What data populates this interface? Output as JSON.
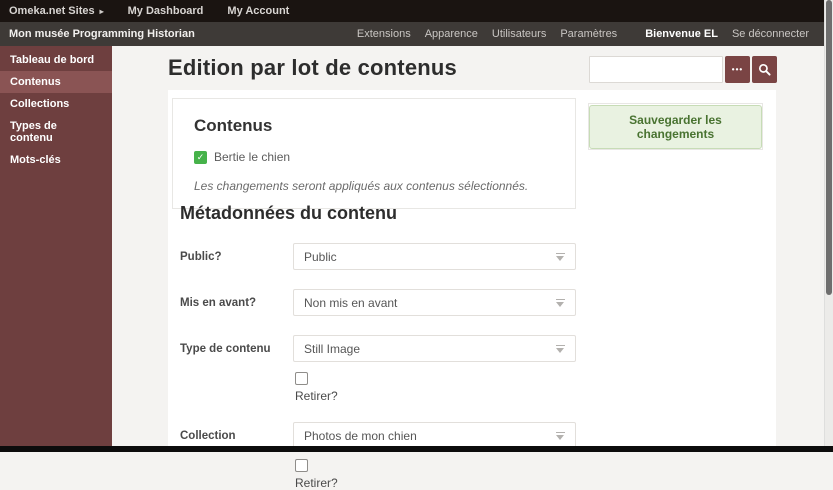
{
  "topbar": {
    "items": [
      {
        "label": "Omeka.net Sites"
      },
      {
        "label": "My Dashboard"
      },
      {
        "label": "My Account"
      }
    ],
    "caret": "▸"
  },
  "adminbar": {
    "site_title": "Mon musée Programming Historian",
    "links": [
      {
        "label": "Extensions"
      },
      {
        "label": "Apparence"
      },
      {
        "label": "Utilisateurs"
      },
      {
        "label": "Paramètres"
      }
    ],
    "welcome": "Bienvenue EL",
    "logout": "Se déconnecter"
  },
  "sidebar": {
    "items": [
      {
        "label": "Tableau de bord"
      },
      {
        "label": "Contenus"
      },
      {
        "label": "Collections"
      },
      {
        "label": "Types de contenu"
      },
      {
        "label": "Mots-clés"
      }
    ]
  },
  "header": {
    "title": "Edition par lot de contenus",
    "search": {
      "value": "",
      "options_button": "•••"
    }
  },
  "items_panel": {
    "title": "Contenus",
    "checkbox": {
      "label": "Bertie le chien",
      "checked": true,
      "checkmark": "✓"
    },
    "note": "Les changements seront appliqués aux contenus sélectionnés."
  },
  "save": {
    "button_label": "Sauvegarder les changements"
  },
  "form": {
    "title": "Métadonnées du contenu",
    "rows": [
      {
        "label": "Public?",
        "value": "Public"
      },
      {
        "label": "Mis en avant?",
        "value": "Non mis en avant"
      },
      {
        "label": "Type de contenu",
        "value": "Still Image",
        "remove_label": "Retirer?"
      },
      {
        "label": "Collection",
        "value": "Photos de mon chien",
        "remove_label": "Retirer?"
      }
    ]
  },
  "colors": {
    "accent_maroon": "#6e3f3f",
    "maroon_active": "#8a5454",
    "button_maroon": "#7a4444",
    "green_checkbox": "#46b24a",
    "save_green_bg": "#e9f2e1",
    "save_green_text": "#497331",
    "topbar_bg": "#1a1411",
    "adminbar_bg": "#3e3a37",
    "page_bg": "#f4f3f1"
  }
}
